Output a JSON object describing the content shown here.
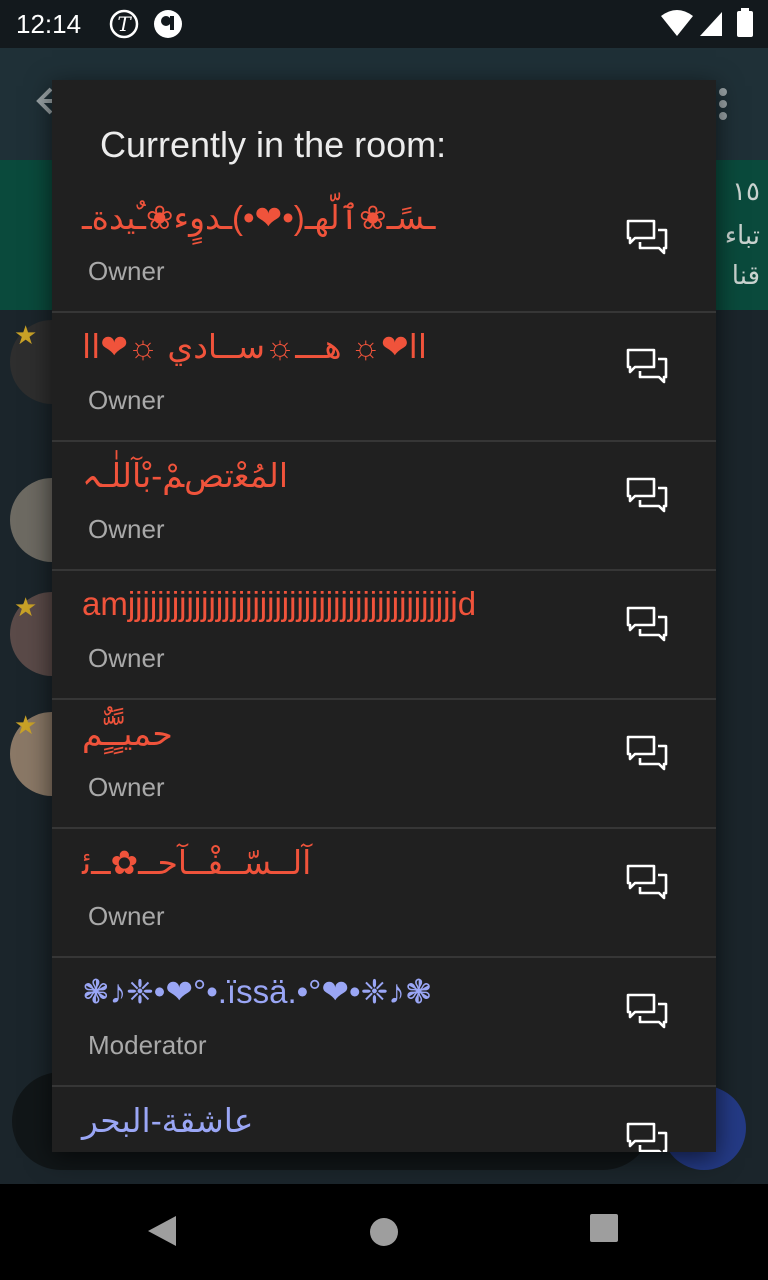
{
  "status_bar": {
    "time": "12:14",
    "left_icons": [
      "t-circle-icon",
      "shield-app-icon"
    ],
    "right_icons": [
      "wifi-icon",
      "signal-icon",
      "battery-icon"
    ]
  },
  "background": {
    "banner_lines": [
      "١٥",
      "تباء",
      "قنا"
    ]
  },
  "dialog": {
    "title": "Currently in the room:",
    "members": [
      {
        "name": "ـسًـ❀ٱلّهـ(•❤•)ـدوٍء❀ـٌيدةـ",
        "role": "Owner",
        "name_color": "#f0533b"
      },
      {
        "name": "اا❤☼ هـــ☼ســادي ☼❤اا",
        "role": "Owner",
        "name_color": "#f0533b"
      },
      {
        "name": "اﻟﻤُﻌْتصﻢْ-بْآللٰـہ",
        "role": "Owner",
        "name_color": "#f0533b"
      },
      {
        "name": "amjjjjjjjjjjjjjjjjjjjjjjjjjjjjjjjjjjjjjjjjjjjjjd",
        "role": "Owner",
        "name_color": "#f0533b"
      },
      {
        "name": "حميـًٍّـٌٍّم",
        "role": "Owner",
        "name_color": "#f0533b"
      },
      {
        "name": "آلــسّــفْــآحــ✿ــﺋ",
        "role": "Owner",
        "name_color": "#f0533b"
      },
      {
        "name": "❃♪❈•❤°•.ïssä.•°❤•❈♪❃",
        "role": "Moderator",
        "name_color": "#9aa6f5"
      },
      {
        "name": "عاشقة-البحر",
        "role": "",
        "name_color": "#9aa6f5"
      }
    ]
  },
  "colors": {
    "owner": "#f0533b",
    "moderator": "#9aa6f5",
    "dialog_bg": "#202020"
  }
}
